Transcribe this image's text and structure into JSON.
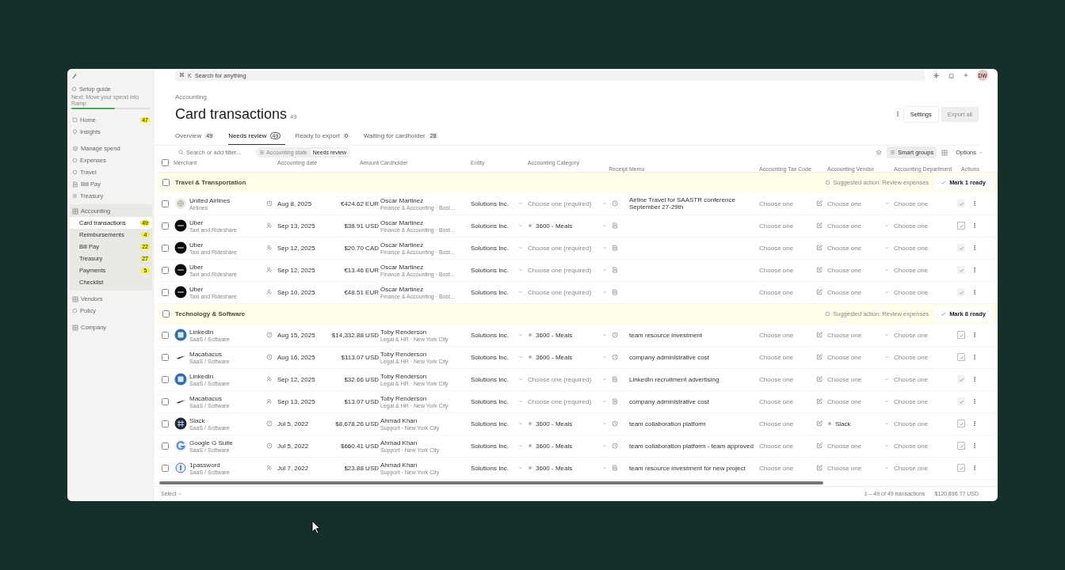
{
  "topbar": {
    "shortcut": [
      "⌘",
      "K"
    ],
    "search_placeholder": "Search for anything",
    "avatar": "DW"
  },
  "sidebar": {
    "setup": {
      "title": "Setup guide",
      "next": "Next: Move your spend into Ramp",
      "level": 0.55
    },
    "items": [
      {
        "label": "Home",
        "badge": "47",
        "selected": false
      },
      {
        "label": "Insights",
        "selected": false
      },
      {
        "label": "Manage spend",
        "selected": false
      },
      {
        "label": "Expenses",
        "selected": false
      },
      {
        "label": "Travel",
        "selected": false
      },
      {
        "label": "Bill Pay",
        "selected": false
      },
      {
        "label": "Treasury",
        "selected": false
      },
      {
        "label": "Accounting",
        "selected": false,
        "children": [
          {
            "label": "Card transactions",
            "badge": "49",
            "selected": true
          },
          {
            "label": "Reimbursements",
            "badge": "4",
            "selected": false
          },
          {
            "label": "Bill Pay",
            "badge": "22",
            "selected": false
          },
          {
            "label": "Treasury",
            "badge": "27",
            "selected": false
          },
          {
            "label": "Payments",
            "badge": "5",
            "selected": false
          },
          {
            "label": "Checklist",
            "selected": false
          }
        ]
      },
      {
        "label": "Vendors",
        "selected": false
      },
      {
        "label": "Policy",
        "selected": false
      },
      {
        "label": "Company",
        "selected": false
      }
    ]
  },
  "breadcrumb": "Accounting",
  "title": "Card transactions",
  "title_count": "49",
  "header_buttons": [
    {
      "label": "Settings",
      "disabled": false
    },
    {
      "label": "Export all",
      "disabled": true
    }
  ],
  "tabs": [
    {
      "label": "Overview",
      "count": "49",
      "selected": false
    },
    {
      "label": "Needs review",
      "count": "49",
      "selected": true
    },
    {
      "label": "Ready to export",
      "count": "0",
      "selected": false
    },
    {
      "label": "Waiting for cardholder",
      "count": "28",
      "selected": false
    }
  ],
  "filter": {
    "placeholder": "Search or add filter...",
    "chip_key": "Accounting state",
    "chip_value": "Needs review"
  },
  "toolbar": {
    "smart_groups": {
      "label": "Smart groups",
      "selected": true
    },
    "options": "Options"
  },
  "select_all_checked": false,
  "columns": [
    "Merchant",
    "Accounting date",
    "Amount",
    "Cardholder",
    "Entity",
    "Accounting Category",
    "Receipt",
    "Memo",
    "Accounting Tax Code",
    "Accounting Vendor",
    "Accounting Department",
    "Actions"
  ],
  "groups": [
    {
      "checked": false,
      "label": "Travel & Transportation",
      "suggestion": "Suggested action: Review expenses",
      "action": "Mark 1 ready",
      "rows": [
        {
          "checked": false,
          "merchant": "United Airlines",
          "merchant_category": "Airlines",
          "date": "Aug 8, 2025",
          "amount": "€424.62 EUR",
          "cardholder": "Oscar Martinez",
          "department": "Finance & Accounting · Bost…",
          "entity": "Solutions Inc.",
          "category": {
            "kind": "placeholder",
            "text": "Choose one (required)"
          },
          "memo": "Airline Travel for SAASTR conference September 27-29th",
          "tax_code": "Choose one",
          "vendor": {
            "kind": "placeholder",
            "text": "Choose one"
          },
          "accounting_department": "Choose one",
          "disabled": true
        },
        {
          "checked": false,
          "merchant": "Uber",
          "merchant_category": "Taxi and Rideshare",
          "date": "Sep 13, 2025",
          "amount": "$38.91 USD",
          "cardholder": "Oscar Martinez",
          "department": "Finance & Accounting · Bost…",
          "entity": "Solutions Inc.",
          "category": {
            "kind": "value",
            "text": "3600 - Meals"
          },
          "tax_code": "Choose one",
          "vendor": {
            "kind": "placeholder",
            "text": "Choose one"
          },
          "accounting_department": "Choose one",
          "disabled": false
        },
        {
          "checked": false,
          "merchant": "Uber",
          "merchant_category": "Taxi and Rideshare",
          "date": "Sep 12, 2025",
          "amount": "$20.70 CAD",
          "cardholder": "Oscar Martinez",
          "department": "Finance & Accounting · Bost…",
          "entity": "Solutions Inc.",
          "category": {
            "kind": "placeholder",
            "text": "Choose one (required)"
          },
          "tax_code": "Choose one",
          "vendor": {
            "kind": "placeholder",
            "text": "Choose one"
          },
          "accounting_department": "Choose one",
          "disabled": true
        },
        {
          "checked": false,
          "merchant": "Uber",
          "merchant_category": "Taxi and Rideshare",
          "date": "Sep 12, 2025",
          "amount": "€13.46 EUR",
          "cardholder": "Oscar Martinez",
          "department": "Finance & Accounting · Bost…",
          "entity": "Solutions Inc.",
          "category": {
            "kind": "placeholder",
            "text": "Choose one (required)"
          },
          "tax_code": "Choose one",
          "vendor": {
            "kind": "placeholder",
            "text": "Choose one"
          },
          "accounting_department": "Choose one",
          "disabled": true
        },
        {
          "checked": false,
          "merchant": "Uber",
          "merchant_category": "Taxi and Rideshare",
          "date": "Sep 10, 2025",
          "amount": "€48.51 EUR",
          "cardholder": "Oscar Martinez",
          "department": "Finance & Accounting · Bost…",
          "entity": "Solutions Inc.",
          "category": {
            "kind": "placeholder",
            "text": "Choose one (required)"
          },
          "tax_code": "Choose one",
          "vendor": {
            "kind": "placeholder",
            "text": "Choose one"
          },
          "accounting_department": "Choose one",
          "disabled": true
        }
      ]
    },
    {
      "checked": false,
      "label": "Technology & Software",
      "suggestion": "Suggested action: Review expenses",
      "action": "Mark 8 ready",
      "rows": [
        {
          "checked": false,
          "merchant": "LinkedIn",
          "merchant_category": "SaaS / Software",
          "date": "Aug 15, 2025",
          "amount": "$14,332.88 USD",
          "cardholder": "Toby Renderson",
          "department": "Legal & HR · New York City",
          "entity": "Solutions Inc.",
          "category": {
            "kind": "value",
            "text": "3600 - Meals"
          },
          "memo": "team resource investment",
          "tax_code": "Choose one",
          "vendor": {
            "kind": "placeholder",
            "text": "Choose one"
          },
          "accounting_department": "Choose one",
          "disabled": false
        },
        {
          "checked": false,
          "merchant": "Macabacus",
          "merchant_category": "SaaS / Software",
          "date": "Aug 16, 2025",
          "amount": "$113.07 USD",
          "cardholder": "Toby Renderson",
          "department": "Legal & HR · New York City",
          "entity": "Solutions Inc.",
          "category": {
            "kind": "value",
            "text": "3600 - Meals"
          },
          "memo": "company administrative cost",
          "tax_code": "Choose one",
          "vendor": {
            "kind": "placeholder",
            "text": "Choose one"
          },
          "accounting_department": "Choose one",
          "disabled": false
        },
        {
          "checked": false,
          "merchant": "LinkedIn",
          "merchant_category": "SaaS / Software",
          "date": "Sep 12, 2025",
          "amount": "$32.66 USD",
          "cardholder": "Toby Renderson",
          "department": "Legal & HR · New York City",
          "entity": "Solutions Inc.",
          "category": {
            "kind": "placeholder",
            "text": "Choose one (required)"
          },
          "memo": "LinkedIn recruitment advertising",
          "tax_code": "Choose one",
          "vendor": {
            "kind": "placeholder",
            "text": "Choose one"
          },
          "accounting_department": "Choose one",
          "disabled": true
        },
        {
          "checked": false,
          "merchant": "Macabacus",
          "merchant_category": "SaaS / Software",
          "date": "Sep 13, 2025",
          "amount": "$13.07 USD",
          "cardholder": "Toby Renderson",
          "department": "Legal & HR · New York City",
          "entity": "Solutions Inc.",
          "category": {
            "kind": "placeholder",
            "text": "Choose one (required)"
          },
          "memo": "company administrative cost",
          "tax_code": "Choose one",
          "vendor": {
            "kind": "placeholder",
            "text": "Choose one"
          },
          "accounting_department": "Choose one",
          "disabled": true
        },
        {
          "checked": false,
          "merchant": "Slack",
          "merchant_category": "SaaS / Software",
          "date": "Jul 5, 2022",
          "amount": "$8,678.26 USD",
          "cardholder": "Ahmad Khan",
          "department": "Support · New York City",
          "entity": "Solutions Inc.",
          "category": {
            "kind": "value",
            "text": "3600 - Meals"
          },
          "memo": "team collaboration platform",
          "tax_code": "Choose one",
          "vendor": {
            "kind": "value",
            "text": "Slack"
          },
          "accounting_department": "Choose one",
          "disabled": false
        },
        {
          "checked": false,
          "merchant": "Google G Suite",
          "merchant_category": "SaaS / Software",
          "date": "Jul 5, 2022",
          "amount": "$660.41 USD",
          "cardholder": "Ahmad Khan",
          "department": "Support · New York City",
          "entity": "Solutions Inc.",
          "category": {
            "kind": "value",
            "text": "3600 - Meals"
          },
          "memo": "team collaboration platform - team approved",
          "tax_code": "Choose one",
          "vendor": {
            "kind": "placeholder",
            "text": "Choose one"
          },
          "accounting_department": "Choose one",
          "disabled": false
        },
        {
          "checked": false,
          "merchant": "1password",
          "merchant_category": "SaaS / Software",
          "date": "Jul 7, 2022",
          "amount": "$23.88 USD",
          "cardholder": "Ahmad Khan",
          "department": "Support · New York City",
          "entity": "Solutions Inc.",
          "category": {
            "kind": "value",
            "text": "3600 - Meals"
          },
          "memo": "team resource investment for new project",
          "tax_code": "Choose one",
          "vendor": {
            "kind": "placeholder",
            "text": "Choose one"
          },
          "accounting_department": "Choose one",
          "disabled": false
        }
      ]
    }
  ],
  "footer": {
    "select": "Select",
    "range": "1 – 49 of 49 transactions",
    "total": "$120,896.77 USD"
  }
}
